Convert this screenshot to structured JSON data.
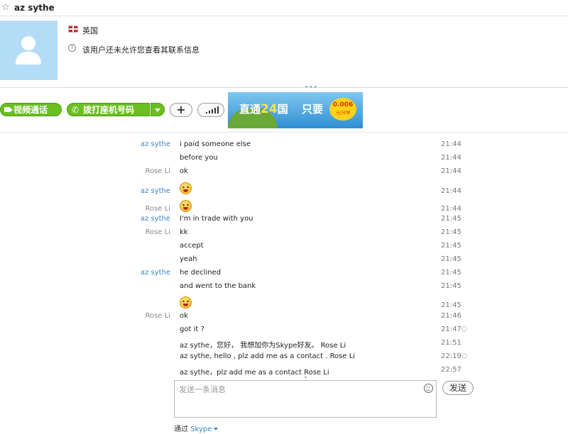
{
  "header": {
    "contact_name": "az sythe"
  },
  "profile": {
    "country": "英国",
    "privacy_note": "该用户还未允许您查看其联系信息"
  },
  "toolbar": {
    "video_call": "视频通话",
    "call_landline": "拨打座机号码",
    "add": "+"
  },
  "ad": {
    "line1_a": "直通",
    "line1_num": "24",
    "line1_b": "国",
    "line2": "只要",
    "price": "0.006",
    "price_unit": "元/分钟"
  },
  "messages": [
    {
      "sender": "az sythe",
      "text": "i paid someone else",
      "time": "21:44"
    },
    {
      "sender": "",
      "text": "before you",
      "time": "21:44"
    },
    {
      "sender": "Rose Li",
      "text": "ok",
      "time": "21:44"
    },
    {
      "sender": "az sythe",
      "text": "",
      "emoji": "tongue-emoji",
      "time": "21:44"
    },
    {
      "sender": "Rose Li",
      "text": "",
      "emoji": "smile-emoji",
      "time": "21:44"
    },
    {
      "sender": "az sythe",
      "text": "I'm in trade with you",
      "time": "21:45"
    },
    {
      "sender": "Rose Li",
      "text": "kk",
      "time": "21:45"
    },
    {
      "sender": "",
      "text": "accept",
      "time": "21:45"
    },
    {
      "sender": "",
      "text": "yeah",
      "time": "21:45"
    },
    {
      "sender": "az sythe",
      "text": "he declined",
      "time": "21:45"
    },
    {
      "sender": "",
      "text": "and went to the bank",
      "time": "21:45"
    },
    {
      "sender": "",
      "text": "",
      "emoji": "tongue-emoji",
      "time": "21:45"
    },
    {
      "sender": "Rose Li",
      "text": "ok",
      "time": "21:46"
    },
    {
      "sender": "",
      "text": "got it ?",
      "time": "21:47",
      "pending": true
    },
    {
      "sender": "",
      "text": "az sythe，您好， 我想加你为Skype好友。 Rose Li",
      "time": "21:51"
    },
    {
      "sender": "",
      "text": "az sythe, hello , plz add me as a contact . Rose Li",
      "time": "22:19",
      "pending": true
    },
    {
      "sender": "",
      "text": "az sythe，plz add me as a contact Rose Li",
      "time": "22:57"
    }
  ],
  "composer": {
    "placeholder": "发送一条消息",
    "send_label": "发送",
    "via_label": "通过",
    "via_service": "Skype"
  },
  "colors": {
    "green": "#6abf1f",
    "link_blue": "#3a85c6"
  }
}
